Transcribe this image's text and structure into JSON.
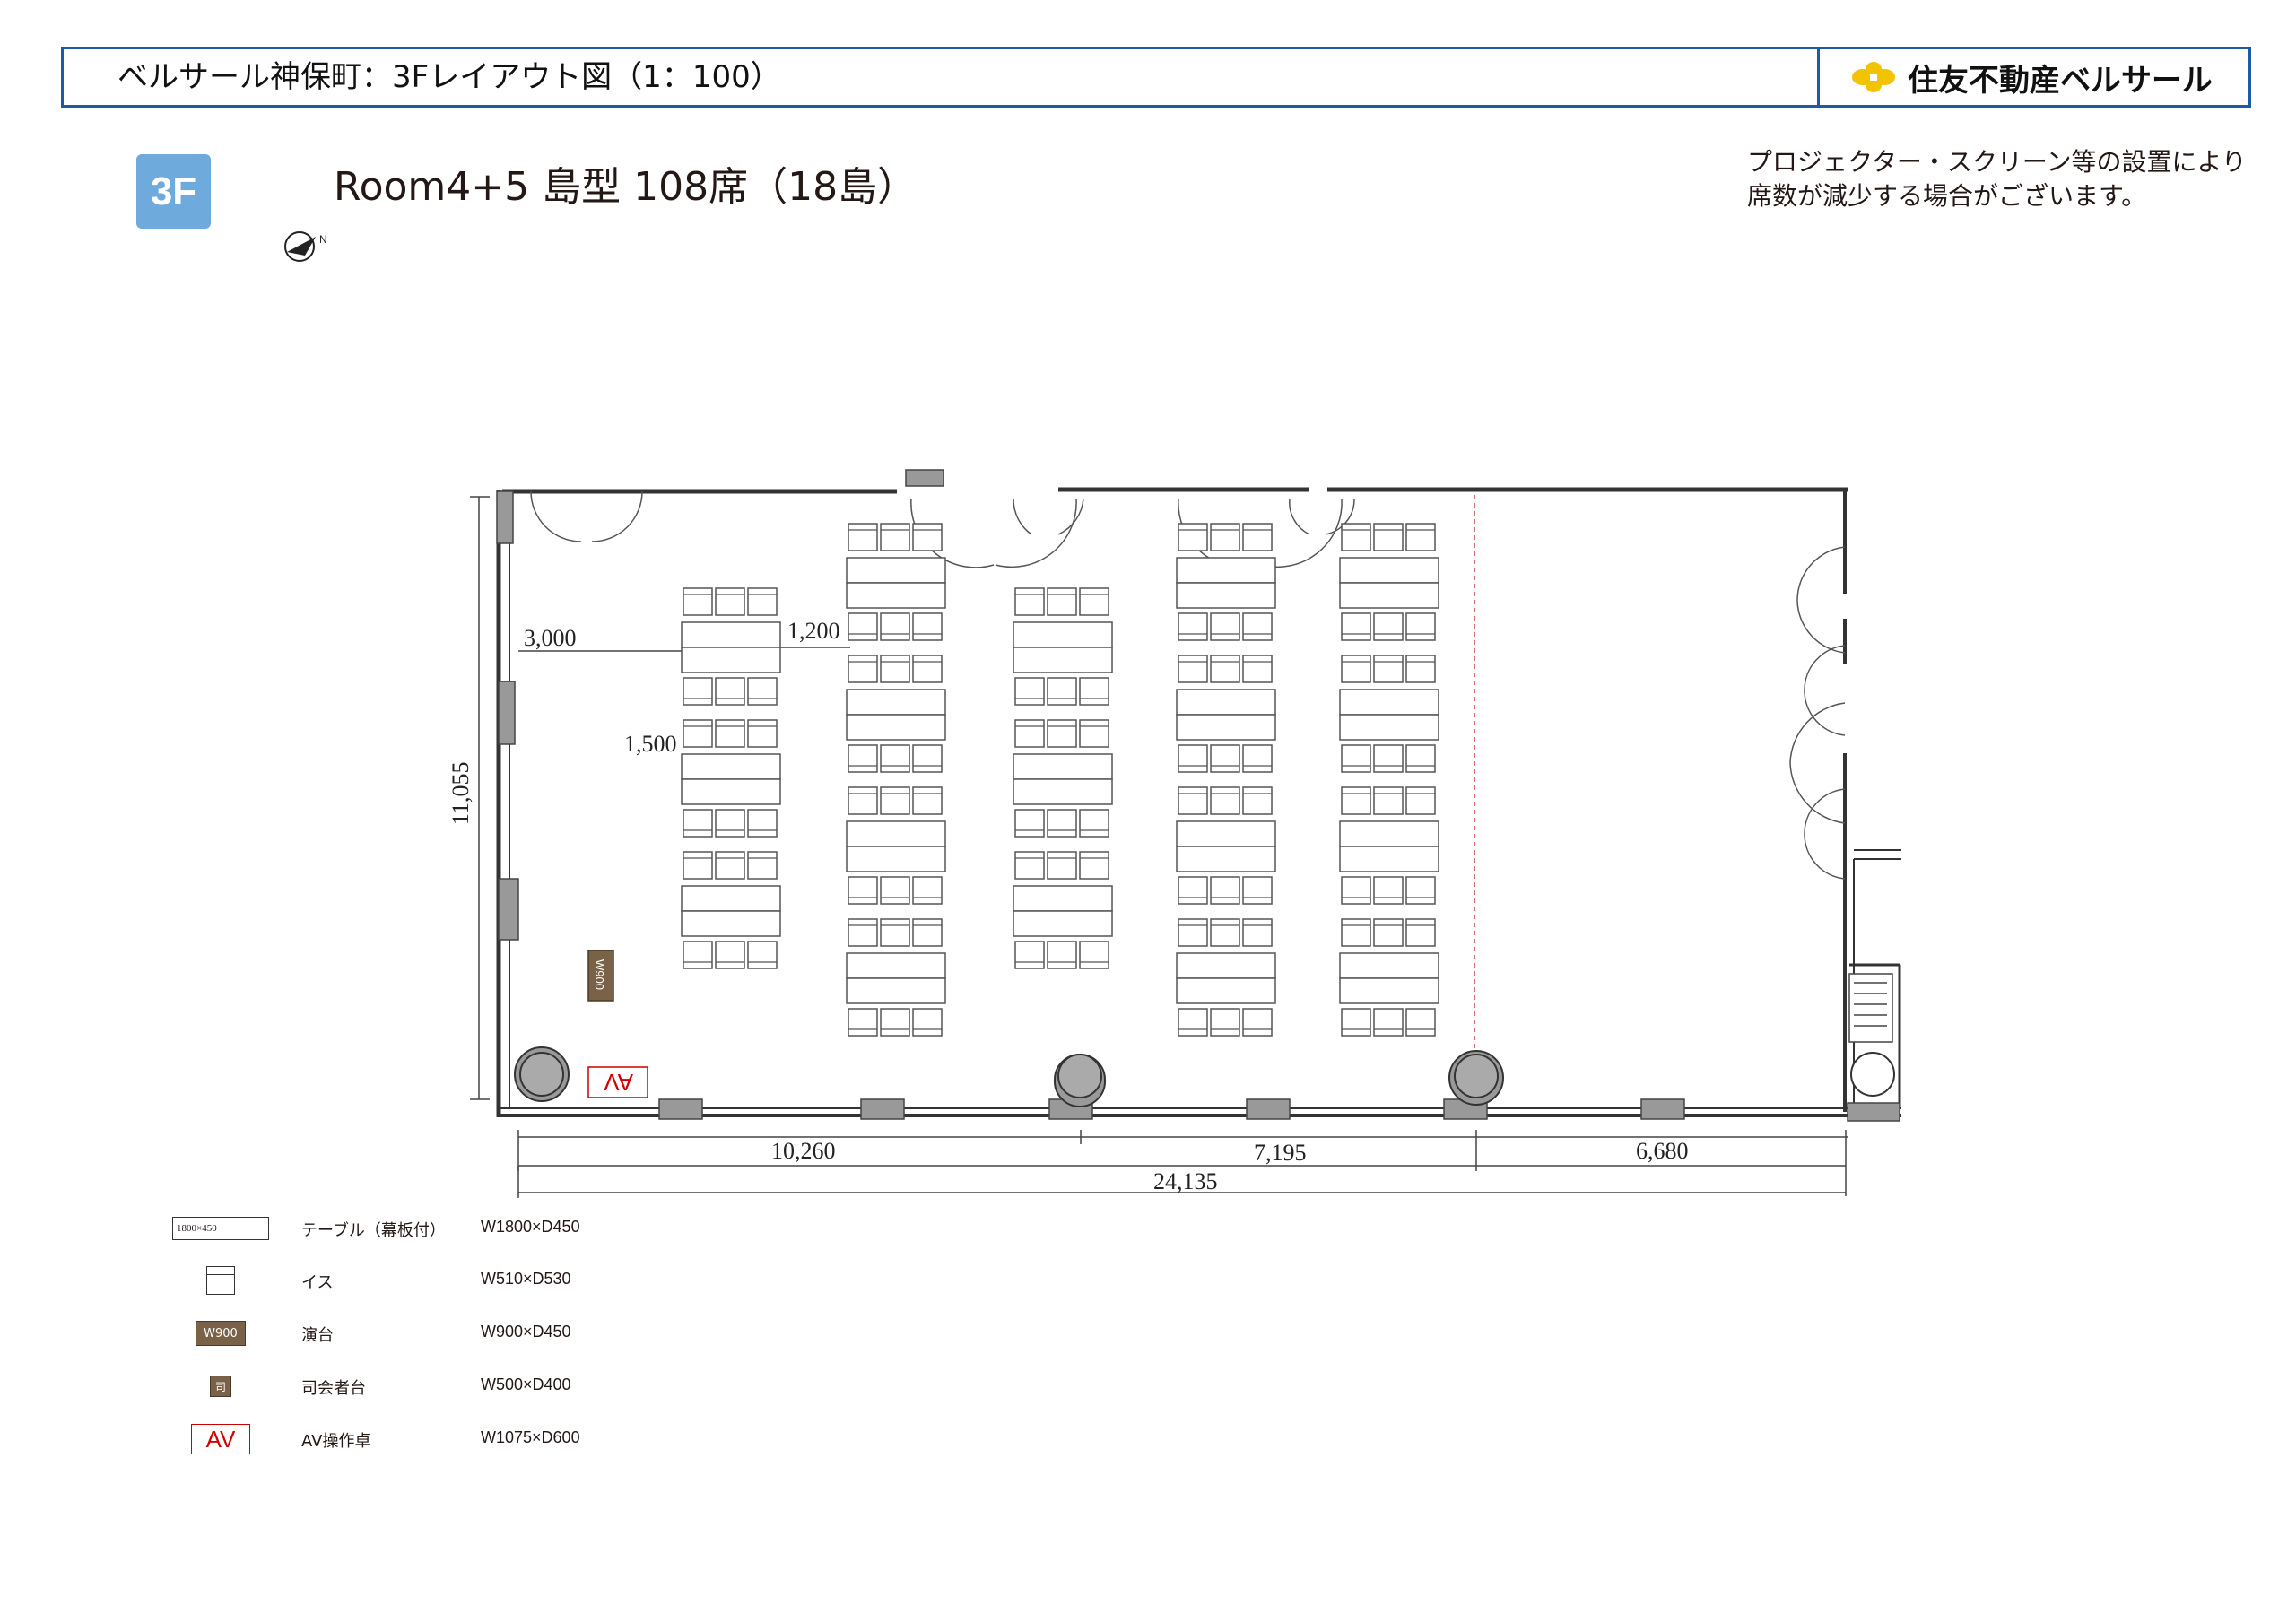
{
  "header": {
    "title": "ベルサール神保町：3Fレイアウト図（1：100）",
    "brand": "住友不動産ベルサール",
    "brand_color": "#f2c400",
    "accent_color": "#1e5aa8"
  },
  "floor_badge": {
    "label": "3F",
    "color": "#6eaadc"
  },
  "layout_title": "Room4+5 島型 108席（18島）",
  "notice": [
    "プロジェクター・スクリーン等の設置により",
    "席数が減少する場合がございます。"
  ],
  "compass_label": "N",
  "dimensions": {
    "aisle_left": "3,000",
    "island_gap": "1,200",
    "row_gap": "1,500",
    "room_depth": "11,055",
    "segment_1": "10,260",
    "segment_2": "7,195",
    "segment_3": "6,680",
    "total_width": "24,135"
  },
  "podium_label": "W900",
  "av_label": "AV",
  "legend": [
    {
      "symbol": "table",
      "symbol_text": "1800×450",
      "name": "テーブル（幕板付）",
      "dim": "W1800×D450"
    },
    {
      "symbol": "chair",
      "symbol_text": "",
      "name": "イス",
      "dim": "W510×D530"
    },
    {
      "symbol": "podium",
      "symbol_text": "W900",
      "name": "演台",
      "dim": "W900×D450"
    },
    {
      "symbol": "mc",
      "symbol_text": "司",
      "name": "司会者台",
      "dim": "W500×D400"
    },
    {
      "symbol": "av",
      "symbol_text": "AV",
      "name": "AV操作卓",
      "dim": "W1075×D600"
    }
  ]
}
